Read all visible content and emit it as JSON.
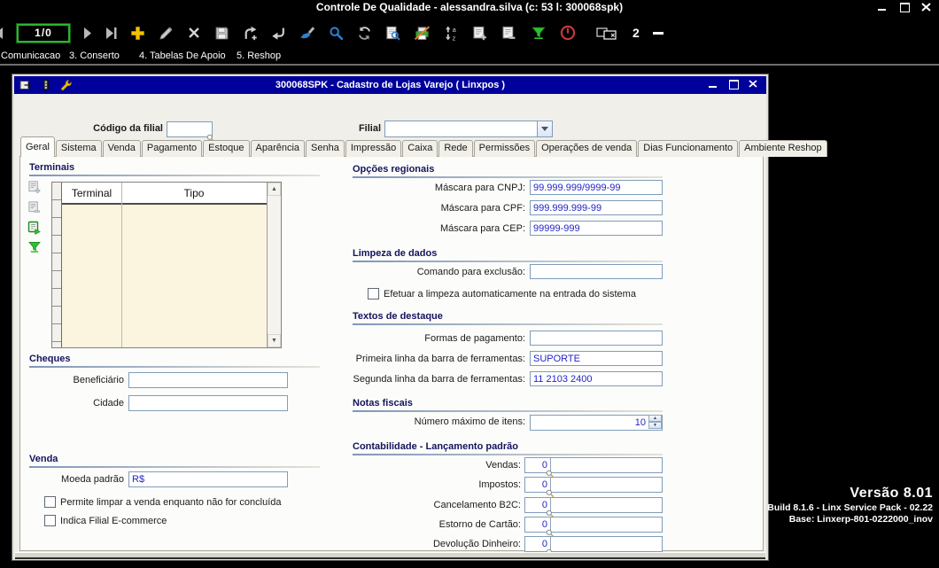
{
  "window": {
    "title": "Controle De Qualidade - alessandra.silva (c: 53 l: 300068spk)"
  },
  "toolbar": {
    "record_counter": "1/0",
    "window_count": "2",
    "icons": [
      "nav-first",
      "nav-next",
      "nav-last",
      "add",
      "edit",
      "delete",
      "save",
      "redo",
      "undo",
      "brush",
      "search",
      "refresh",
      "preview",
      "print-disabled",
      "sort-az",
      "doc-add",
      "doc-remove",
      "filter",
      "stop",
      "cascade-windows",
      "minimize-all"
    ]
  },
  "menu": {
    "items": [
      "Comunicacao",
      "3. Conserto",
      "4. Tabelas De Apoio",
      "5. Reshop"
    ]
  },
  "dialog": {
    "title": "300068SPK - Cadastro de Lojas Varejo ( Linxpos )",
    "codigo_label": "Código da filial",
    "codigo_value": "",
    "filial_label": "Filial",
    "filial_value": "",
    "tabs": [
      "Geral",
      "Sistema",
      "Venda",
      "Pagamento",
      "Estoque",
      "Aparência",
      "Senha",
      "Impressão",
      "Caixa",
      "Rede",
      "Permissões",
      "Operações de venda",
      "Dias Funcionamento",
      "Ambiente Reshop"
    ],
    "active_tab": "Geral",
    "groups": {
      "terminais": {
        "label": "Terminais",
        "columns": [
          "Terminal",
          "Tipo"
        ],
        "rows": []
      },
      "cheques": {
        "label": "Cheques",
        "fields": [
          {
            "label": "Beneficiário",
            "value": ""
          },
          {
            "label": "Cidade",
            "value": ""
          }
        ]
      },
      "venda": {
        "label": "Venda",
        "moeda_label": "Moeda padrão",
        "moeda_value": "R$",
        "checkboxes": [
          {
            "label": "Permite limpar a venda enquanto não for concluída",
            "checked": false
          },
          {
            "label": "Indica Filial E-commerce",
            "checked": false
          }
        ]
      },
      "opcoes_regionais": {
        "label": "Opções regionais",
        "fields": [
          {
            "label": "Máscara para CNPJ:",
            "value": "99.999.999/9999-99"
          },
          {
            "label": "Máscara para CPF:",
            "value": "999.999.999-99"
          },
          {
            "label": "Máscara para CEP:",
            "value": "99999-999"
          }
        ]
      },
      "limpeza": {
        "label": "Limpeza de dados",
        "field_label": "Comando para exclusão:",
        "field_value": "",
        "checkbox": {
          "label": "Efetuar a limpeza automaticamente na entrada do sistema",
          "checked": false
        }
      },
      "textos": {
        "label": "Textos de destaque",
        "fields": [
          {
            "label": "Formas de pagamento:",
            "value": ""
          },
          {
            "label": "Primeira linha da barra de ferramentas:",
            "value": "SUPORTE"
          },
          {
            "label": "Segunda linha da barra de ferramentas:",
            "value": "11 2103 2400"
          }
        ]
      },
      "notas": {
        "label": "Notas fiscais",
        "field_label": "Número máximo de itens:",
        "field_value": "10"
      },
      "contabilidade": {
        "label": "Contabilidade - Lançamento padrão",
        "fields": [
          {
            "label": "Vendas:",
            "value": "0"
          },
          {
            "label": "Impostos:",
            "value": "0"
          },
          {
            "label": "Cancelamento B2C:",
            "value": "0"
          },
          {
            "label": "Estorno de Cartão:",
            "value": "0"
          },
          {
            "label": "Devolução Dinheiro:",
            "value": "0"
          }
        ]
      }
    }
  },
  "version": {
    "line1": "Versão  8.01",
    "line2": "Build 8.1.6 - Linx Service Pack - 02.22",
    "line3": "Base: Linxerp-801-0222000_inov"
  },
  "colors": {
    "dialog_titlebar": "#00009B",
    "value_text": "#2323CC",
    "grid_body": "#FBF5DF",
    "counter_green": "#2DB42D",
    "accent_green": "#2FBF2F",
    "danger_red": "#C23A3A",
    "icon_blue": "#2F7FD0",
    "icon_yellow": "#F2C200"
  }
}
